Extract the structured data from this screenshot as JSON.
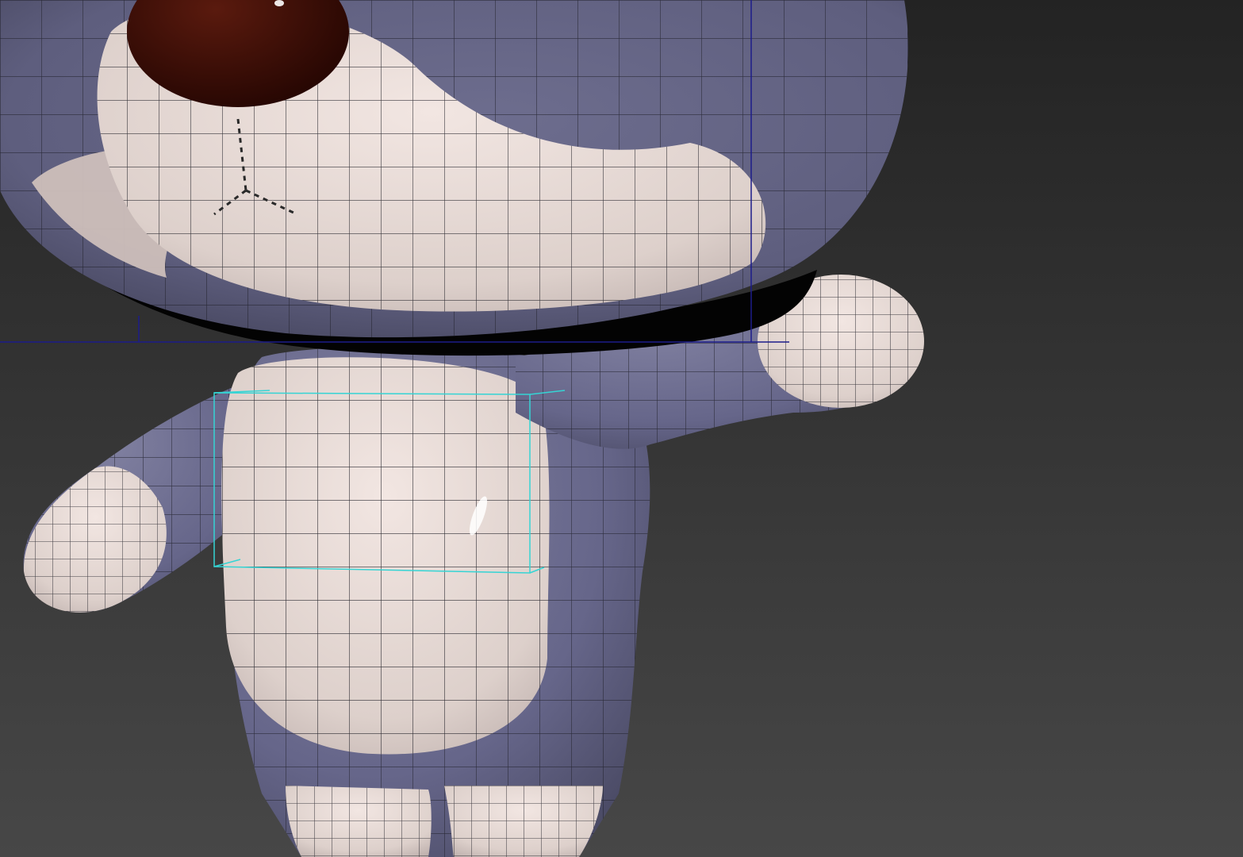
{
  "viewport": {
    "kind": "3d-perspective-viewport",
    "background_top": "#242424",
    "background_bottom": "#474747"
  },
  "model": {
    "subject": "cartoon-teddy-bear",
    "display_mode": "smooth-shaded-with-edged-faces",
    "colors": {
      "fur": "#6c6c8c",
      "fur_dark": "#4e4e66",
      "cream": "#d9c9c4",
      "cream_light": "#efe2dd",
      "nose": "#3a0b04",
      "wire": "#1a1a22",
      "shadow": "#030303"
    }
  },
  "selection": {
    "gizmo_color": "#35d4d4",
    "bounds_color": "#1c1c8a"
  }
}
